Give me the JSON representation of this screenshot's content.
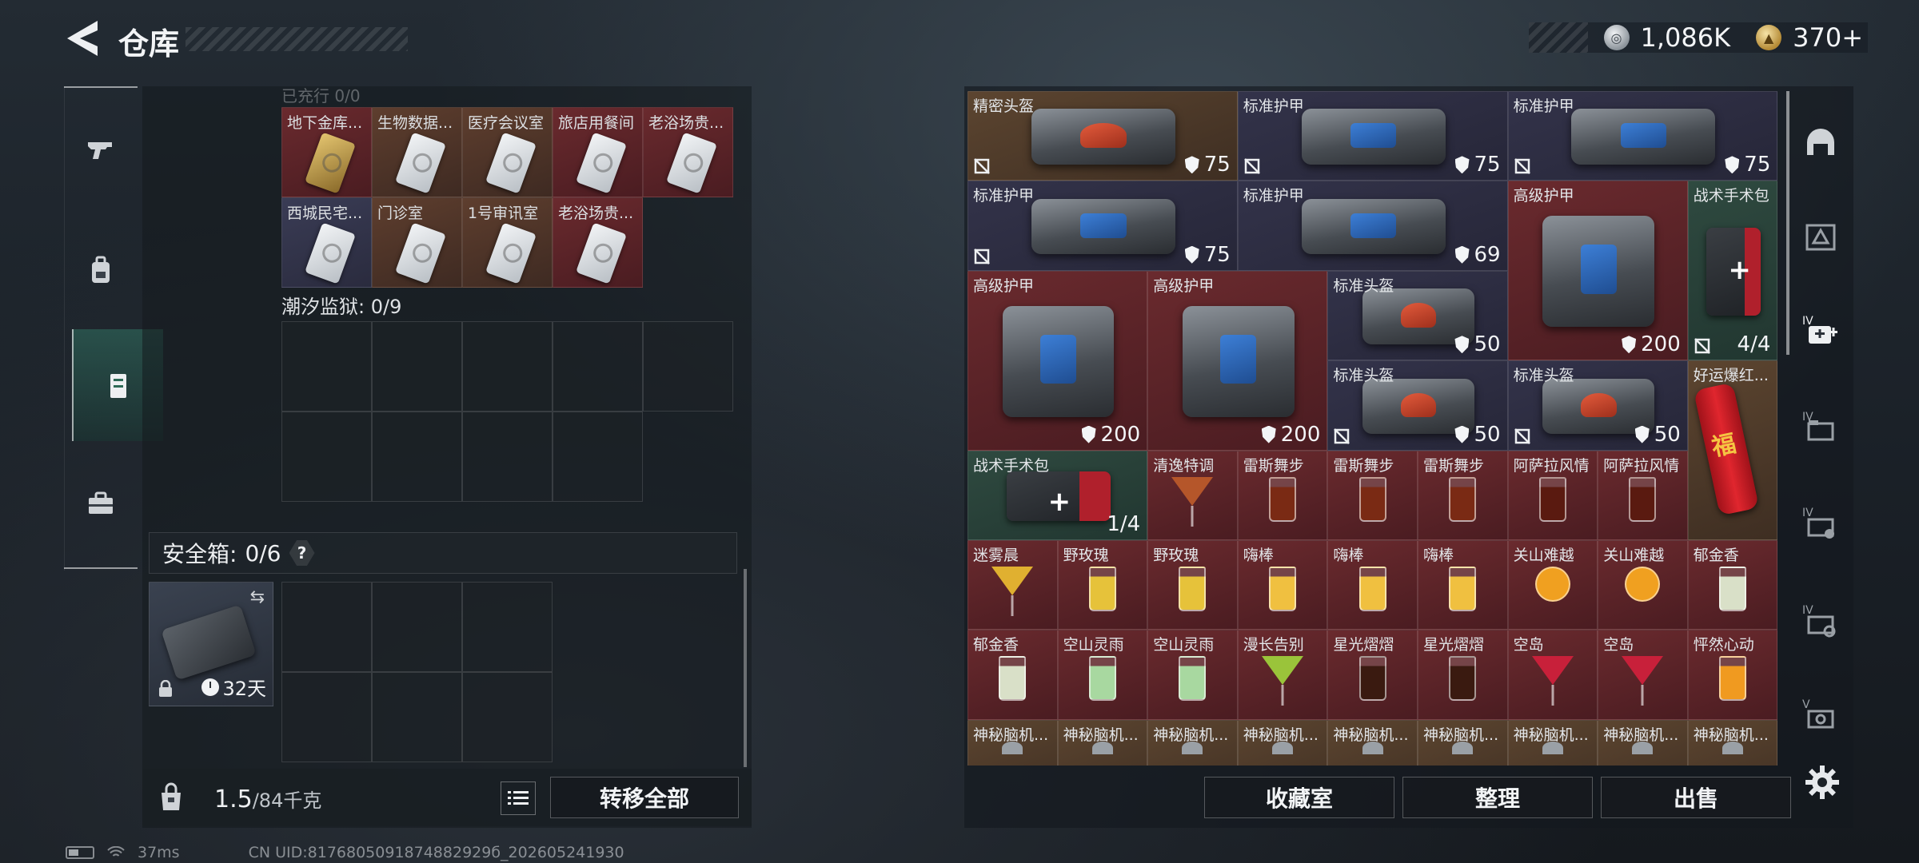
{
  "header": {
    "title": "仓库"
  },
  "currency": [
    {
      "icon": "silver-coin-icon",
      "value": "1,086K"
    },
    {
      "icon": "gold-coin-icon",
      "value": "370+"
    }
  ],
  "nav_rail": [
    {
      "name": "weapon",
      "icon": "pistol-icon"
    },
    {
      "name": "equipment",
      "icon": "backpack-icon"
    },
    {
      "name": "storage",
      "icon": "locker-icon",
      "active": true
    },
    {
      "name": "toolbox",
      "icon": "toolbox-icon"
    }
  ],
  "cards_section": {
    "cut_label": "已充行 0/0",
    "slots": [
      {
        "label": "地下金库...",
        "color": "red",
        "card": "gold"
      },
      {
        "label": "生物数据...",
        "color": "orange",
        "card": "white"
      },
      {
        "label": "医疗会议室",
        "color": "orange",
        "card": "white"
      },
      {
        "label": "旅店用餐间",
        "color": "red",
        "card": "white"
      },
      {
        "label": "老浴场贵...",
        "color": "red",
        "card": "white"
      },
      {
        "label": "西城民宅...",
        "color": "blue",
        "card": "white"
      },
      {
        "label": "门诊室",
        "color": "orange",
        "card": "white"
      },
      {
        "label": "1号审讯室",
        "color": "orange",
        "card": "white"
      },
      {
        "label": "老浴场贵...",
        "color": "red",
        "card": "white"
      }
    ]
  },
  "prison_section": {
    "label": "潮汐监狱: 0/9"
  },
  "safe_box": {
    "title": "安全箱:",
    "count": "0/6",
    "help": "?",
    "timer": "32天"
  },
  "bottom": {
    "weight": "1.5",
    "weight_max": "/84千克",
    "transfer_all": "转移全部"
  },
  "inventory": {
    "items": [
      {
        "label": "精密头盔",
        "color": "brown",
        "kind": "bag",
        "tint": "orange",
        "durability": "75",
        "broken": true
      },
      {
        "label": "标准护甲",
        "color": "blue",
        "kind": "bag",
        "tint": "blue",
        "durability": "75",
        "broken": true
      },
      {
        "label": "标准护甲",
        "color": "blue",
        "kind": "bag",
        "tint": "blue",
        "durability": "75",
        "broken": true
      },
      {
        "label": "标准护甲",
        "color": "blue",
        "kind": "bag",
        "tint": "blue",
        "durability": "75",
        "broken": true
      },
      {
        "label": "标准护甲",
        "color": "blue",
        "kind": "bag",
        "tint": "blue",
        "durability": "69",
        "broken": false
      },
      {
        "label": "高级护甲",
        "color": "red",
        "kind": "bag",
        "tint": "blue",
        "durability": "200",
        "broken": false
      },
      {
        "label": "战术手术包",
        "color": "green",
        "kind": "medkit",
        "count": "4/4",
        "broken": true
      },
      {
        "label": "高级护甲",
        "color": "red",
        "kind": "bag",
        "tint": "blue",
        "durability": "200",
        "broken": false
      },
      {
        "label": "高级护甲",
        "color": "red",
        "kind": "bag",
        "tint": "blue",
        "durability": "200",
        "broken": false
      },
      {
        "label": "标准头盔",
        "color": "blue",
        "kind": "bag",
        "tint": "orange",
        "durability": "50",
        "broken": false
      },
      {
        "label": "好运爆红...",
        "color": "brown",
        "kind": "firecracker"
      },
      {
        "label": "标准头盔",
        "color": "blue",
        "kind": "bag",
        "tint": "orange",
        "durability": "50",
        "broken": true
      },
      {
        "label": "标准头盔",
        "color": "blue",
        "kind": "bag",
        "tint": "orange",
        "durability": "50",
        "broken": true
      },
      {
        "label": "战术手术包",
        "color": "green",
        "kind": "medkit",
        "count": "1/4"
      },
      {
        "label": "清逸特调",
        "color": "red",
        "kind": "drink",
        "drink": "cocktail",
        "tint": "#b5562a"
      },
      {
        "label": "雷斯舞步",
        "color": "red",
        "kind": "drink",
        "drink": "tall",
        "tint": "#7a2a14"
      },
      {
        "label": "雷斯舞步",
        "color": "red",
        "kind": "drink",
        "drink": "tall",
        "tint": "#7a2a14"
      },
      {
        "label": "雷斯舞步",
        "color": "red",
        "kind": "drink",
        "drink": "tall",
        "tint": "#7a2a14"
      },
      {
        "label": "阿萨拉风情",
        "color": "red",
        "kind": "drink",
        "drink": "tall",
        "tint": "#5a1a10"
      },
      {
        "label": "阿萨拉风情",
        "color": "red",
        "kind": "drink",
        "drink": "tall",
        "tint": "#5a1a10"
      },
      {
        "label": "迷雾晨",
        "color": "red",
        "kind": "drink",
        "drink": "cocktail",
        "tint": "#e0b030"
      },
      {
        "label": "野玫瑰",
        "color": "red",
        "kind": "drink",
        "drink": "tall",
        "tint": "#e6c23a"
      },
      {
        "label": "野玫瑰",
        "color": "red",
        "kind": "drink",
        "drink": "tall",
        "tint": "#e6c23a"
      },
      {
        "label": "嗨棒",
        "color": "red",
        "kind": "drink",
        "drink": "tall",
        "tint": "#f0c040"
      },
      {
        "label": "嗨棒",
        "color": "red",
        "kind": "drink",
        "drink": "tall",
        "tint": "#f0c040"
      },
      {
        "label": "嗨棒",
        "color": "red",
        "kind": "drink",
        "drink": "tall",
        "tint": "#f0c040"
      },
      {
        "label": "关山难越",
        "color": "red",
        "kind": "drink",
        "drink": "round",
        "tint": "#f0a020"
      },
      {
        "label": "关山难越",
        "color": "red",
        "kind": "drink",
        "drink": "round",
        "tint": "#f0a020"
      },
      {
        "label": "郁金香",
        "color": "red",
        "kind": "drink",
        "drink": "tall",
        "tint": "#d9e0c8"
      },
      {
        "label": "郁金香",
        "color": "red",
        "kind": "drink",
        "drink": "tall",
        "tint": "#d9e0c8"
      },
      {
        "label": "空山灵雨",
        "color": "red",
        "kind": "drink",
        "drink": "tall",
        "tint": "#a8d8a0"
      },
      {
        "label": "空山灵雨",
        "color": "red",
        "kind": "drink",
        "drink": "tall",
        "tint": "#a8d8a0"
      },
      {
        "label": "漫长告别",
        "color": "red",
        "kind": "drink",
        "drink": "cocktail",
        "tint": "#9ac43a"
      },
      {
        "label": "星光熠熠",
        "color": "red",
        "kind": "drink",
        "drink": "tall",
        "tint": "#3a1a10"
      },
      {
        "label": "星光熠熠",
        "color": "red",
        "kind": "drink",
        "drink": "tall",
        "tint": "#3a1a10"
      },
      {
        "label": "空岛",
        "color": "red",
        "kind": "drink",
        "drink": "cocktail",
        "tint": "#c8203a"
      },
      {
        "label": "空岛",
        "color": "red",
        "kind": "drink",
        "drink": "cocktail",
        "tint": "#c8203a"
      },
      {
        "label": "怦然心动",
        "color": "red",
        "kind": "drink",
        "drink": "tall",
        "tint": "#f09a20"
      },
      {
        "label": "神秘脑机...",
        "color": "brown",
        "kind": "mystery"
      },
      {
        "label": "神秘脑机...",
        "color": "brown",
        "kind": "mystery"
      },
      {
        "label": "神秘脑机...",
        "color": "brown",
        "kind": "mystery"
      },
      {
        "label": "神秘脑机...",
        "color": "brown",
        "kind": "mystery"
      },
      {
        "label": "神秘脑机...",
        "color": "brown",
        "kind": "mystery"
      },
      {
        "label": "神秘脑机...",
        "color": "brown",
        "kind": "mystery"
      },
      {
        "label": "神秘脑机...",
        "color": "brown",
        "kind": "mystery"
      },
      {
        "label": "神秘脑机...",
        "color": "brown",
        "kind": "mystery"
      },
      {
        "label": "神秘脑机...",
        "color": "brown",
        "kind": "mystery"
      }
    ],
    "buttons": {
      "collection": "收藏室",
      "sort": "整理",
      "sell": "出售"
    }
  },
  "side_tabs": [
    {
      "name": "helmet-tab",
      "icon": "helmet-icon"
    },
    {
      "name": "armor-tab",
      "icon": "armor-icon"
    },
    {
      "name": "iv-medkit-tab",
      "icon": "iv-medkit-icon",
      "active": true
    },
    {
      "name": "iv-folder-tab",
      "icon": "iv-folder-icon"
    },
    {
      "name": "iv-card-tab",
      "icon": "iv-card-icon"
    },
    {
      "name": "iv-gear-tab",
      "icon": "iv-gear-icon"
    },
    {
      "name": "v-camera-tab",
      "icon": "v-camera-icon"
    }
  ],
  "status": {
    "ping": "37ms",
    "uid": "CN UID:8176805091874882929б_202605241930"
  }
}
